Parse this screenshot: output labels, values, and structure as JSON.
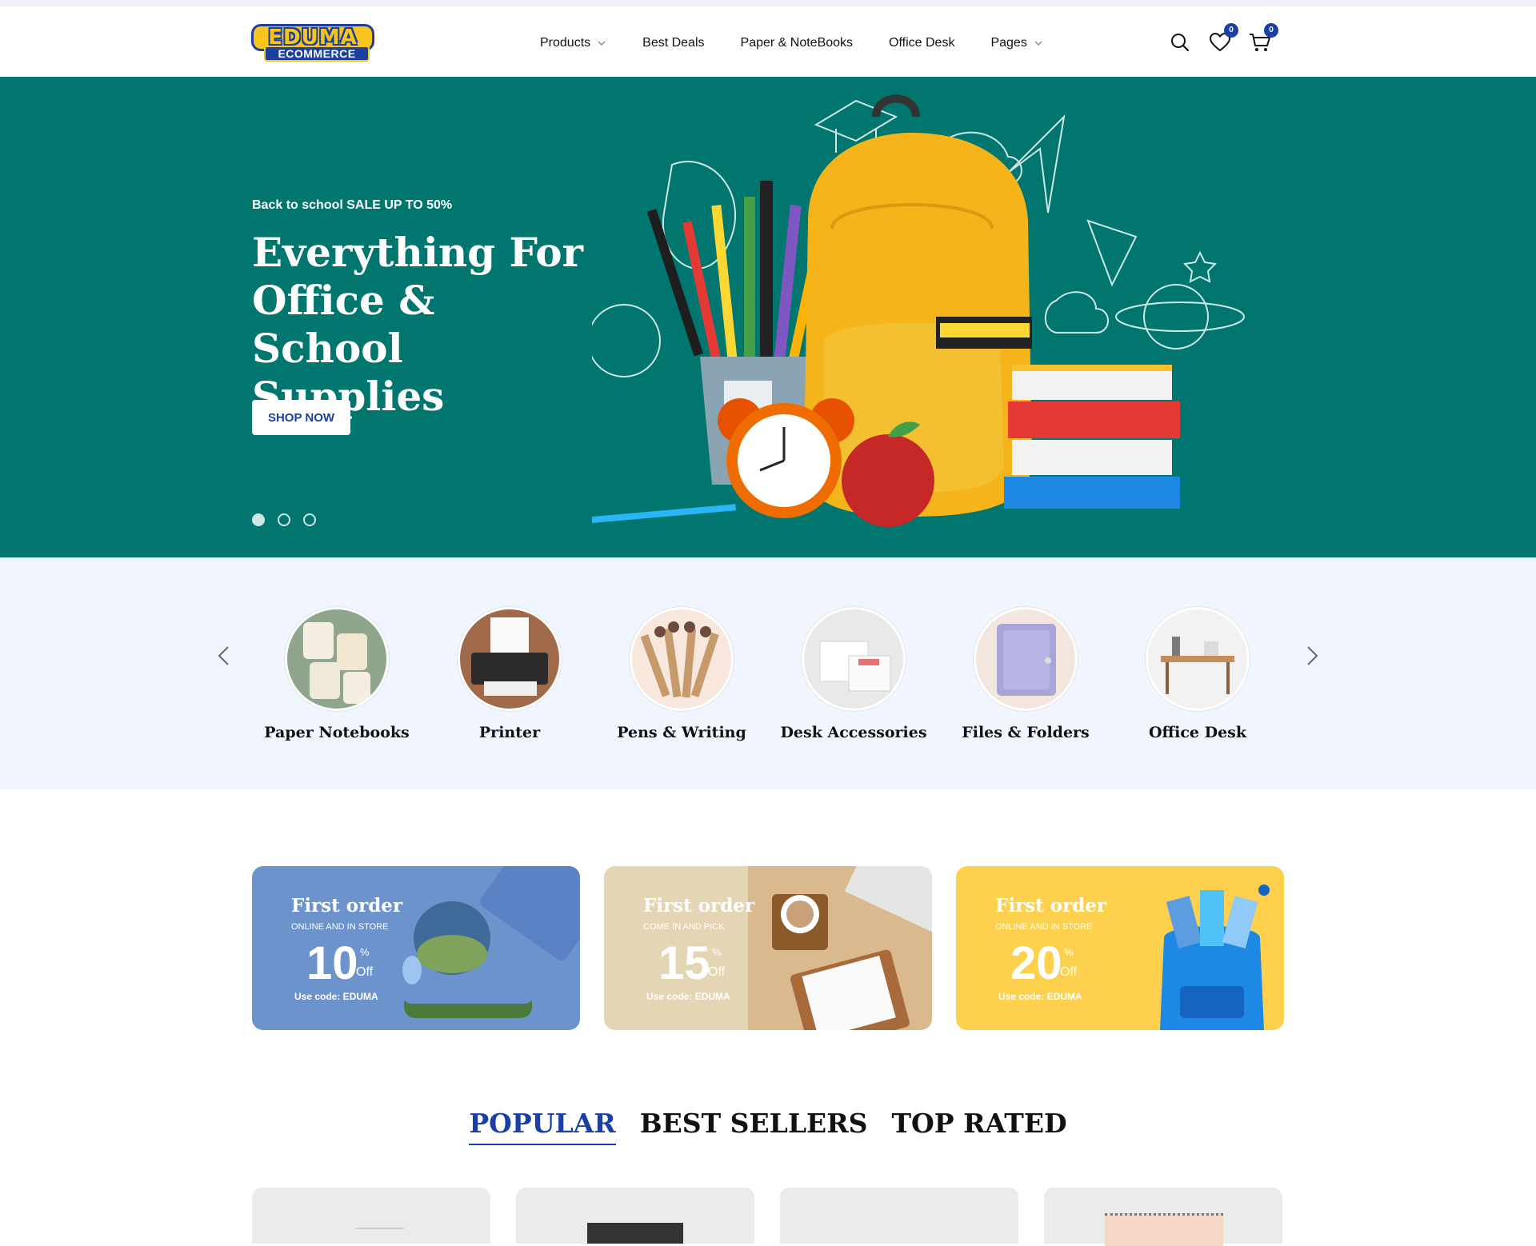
{
  "header": {
    "logo_top": "EDUMA",
    "logo_bottom": "ECOMMERCE",
    "nav": [
      {
        "label": "Products",
        "dropdown": true
      },
      {
        "label": "Best Deals",
        "dropdown": false
      },
      {
        "label": "Paper & NoteBooks",
        "dropdown": false
      },
      {
        "label": "Office Desk",
        "dropdown": false
      },
      {
        "label": "Pages",
        "dropdown": true
      }
    ],
    "wishlist_count": "0",
    "cart_count": "0",
    "icons": [
      "search-icon",
      "heart-icon",
      "cart-icon"
    ]
  },
  "hero": {
    "eyebrow": "Back to school SALE UP TO 50%",
    "title": "Everything For Office & School Supplies",
    "cta": "SHOP NOW",
    "slides": 3,
    "active_slide": 1,
    "bg_color": "#00766e"
  },
  "categories": {
    "items": [
      {
        "label": "Paper Notebooks"
      },
      {
        "label": "Printer"
      },
      {
        "label": "Pens & Writing"
      },
      {
        "label": "Desk Accessories"
      },
      {
        "label": "Files & Folders"
      },
      {
        "label": "Office Desk"
      }
    ]
  },
  "promos": [
    {
      "title": "First order",
      "subtitle": "ONLINE AND IN STORE",
      "percent": "10",
      "pct_symbol": "%",
      "off": "Off",
      "code": "Use code: EDUMA",
      "color": "#6d93cc"
    },
    {
      "title": "First order",
      "subtitle": "COME IN AND PICK",
      "percent": "15",
      "pct_symbol": "%",
      "off": "Off",
      "code": "Use code: EDUMA",
      "color": "#e4d5b5"
    },
    {
      "title": "First order",
      "subtitle": "ONLINE AND IN STORE",
      "percent": "20",
      "pct_symbol": "%",
      "off": "Off",
      "code": "Use code: EDUMA",
      "color": "#fdd14e"
    }
  ],
  "product_tabs": [
    {
      "label": "POPULAR",
      "active": true
    },
    {
      "label": "BEST SELLERS",
      "active": false
    },
    {
      "label": "TOP RATED",
      "active": false
    }
  ],
  "accent_color": "#1a3fa6"
}
